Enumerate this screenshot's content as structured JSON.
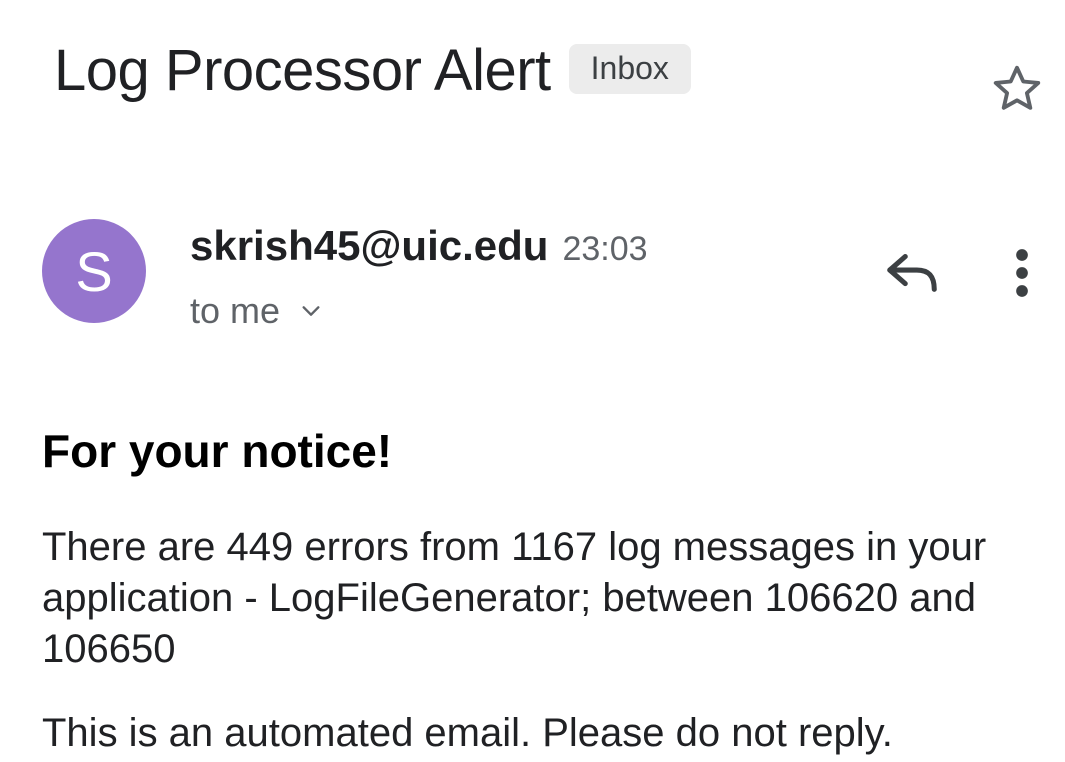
{
  "email": {
    "subject": "Log Processor Alert",
    "label": "Inbox",
    "sender": {
      "initial": "S",
      "address": "skrish45@uic.edu",
      "time": "23:03",
      "recipient": "to me",
      "avatar_color": "#9575cd"
    },
    "body": {
      "heading": "For your notice!",
      "paragraph1": "There are 449 errors from 1167 log messages in your application - LogFileGenerator; between 106620 and 106650",
      "paragraph2": "This is an automated email. Please do not reply."
    }
  },
  "icons": {
    "star": "star-icon",
    "reply": "reply-icon",
    "more": "more-vert-icon",
    "expand": "chevron-down-icon"
  }
}
